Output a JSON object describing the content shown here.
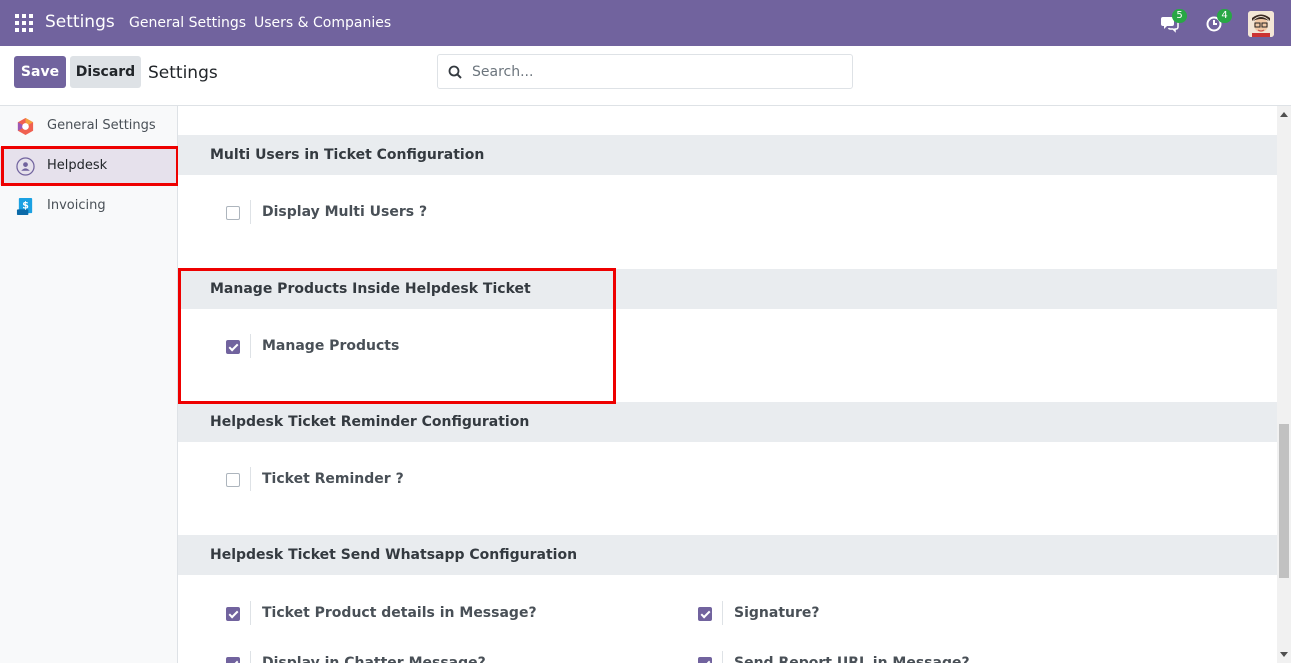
{
  "navbar": {
    "brand": "Settings",
    "menus": [
      "General Settings",
      "Users & Companies"
    ],
    "messages_badge": "5",
    "activities_badge": "4",
    "bg_color": "#71639e"
  },
  "control_panel": {
    "save_label": "Save",
    "discard_label": "Discard",
    "title": "Settings",
    "search_placeholder": "Search..."
  },
  "sidebar": {
    "items": [
      {
        "label": "General Settings",
        "icon": "odoo-logo-icon"
      },
      {
        "label": "Helpdesk",
        "icon": "helpdesk-icon",
        "active": true
      },
      {
        "label": "Invoicing",
        "icon": "invoicing-icon"
      }
    ]
  },
  "sections": [
    {
      "title": "Multi Users in Ticket Configuration",
      "settings": [
        {
          "label": "Display Multi Users ?",
          "checked": false
        }
      ]
    },
    {
      "title": "Manage Products Inside Helpdesk Ticket",
      "settings": [
        {
          "label": "Manage Products",
          "checked": true
        }
      ]
    },
    {
      "title": "Helpdesk Ticket Reminder Configuration",
      "settings": [
        {
          "label": "Ticket Reminder ?",
          "checked": false
        }
      ]
    },
    {
      "title": "Helpdesk Ticket Send Whatsapp Configuration",
      "settings": [
        {
          "label": "Ticket Product details in Message?",
          "checked": true
        },
        {
          "label": "Signature?",
          "checked": true
        },
        {
          "label": "Display in Chatter Message?",
          "checked": true
        },
        {
          "label": "Send Report URL in Message?",
          "checked": true
        }
      ]
    }
  ],
  "colors": {
    "accent": "#71639e",
    "highlight": "#ee0000"
  }
}
